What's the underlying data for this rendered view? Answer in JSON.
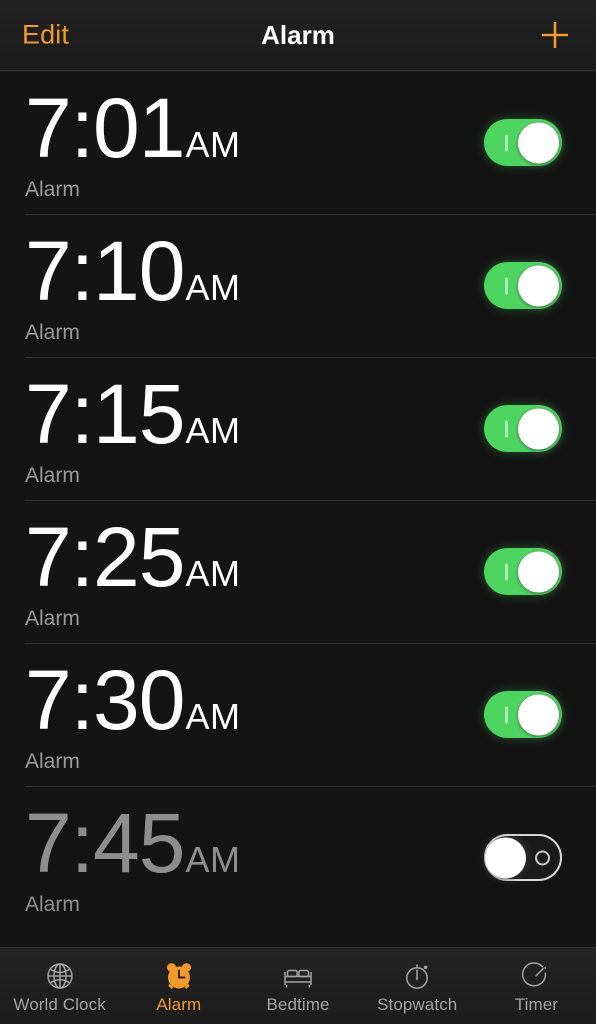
{
  "app": {
    "title": "Alarm",
    "accent_color": "#f09a2e",
    "toggle_on_color": "#4cd45f",
    "background_color": "#141414"
  },
  "header": {
    "edit_label": "Edit",
    "title": "Alarm",
    "add_icon": "plus-icon"
  },
  "alarms": [
    {
      "time": "7:01",
      "meridiem": "AM",
      "label": "Alarm",
      "enabled": true
    },
    {
      "time": "7:10",
      "meridiem": "AM",
      "label": "Alarm",
      "enabled": true
    },
    {
      "time": "7:15",
      "meridiem": "AM",
      "label": "Alarm",
      "enabled": true
    },
    {
      "time": "7:25",
      "meridiem": "AM",
      "label": "Alarm",
      "enabled": true
    },
    {
      "time": "7:30",
      "meridiem": "AM",
      "label": "Alarm",
      "enabled": true
    },
    {
      "time": "7:45",
      "meridiem": "AM",
      "label": "Alarm",
      "enabled": false
    }
  ],
  "tabbar": {
    "active_index": 1,
    "items": [
      {
        "label": "World Clock",
        "icon": "globe-icon"
      },
      {
        "label": "Alarm",
        "icon": "alarm-clock-icon"
      },
      {
        "label": "Bedtime",
        "icon": "bed-icon"
      },
      {
        "label": "Stopwatch",
        "icon": "stopwatch-icon"
      },
      {
        "label": "Timer",
        "icon": "timer-icon"
      }
    ]
  }
}
